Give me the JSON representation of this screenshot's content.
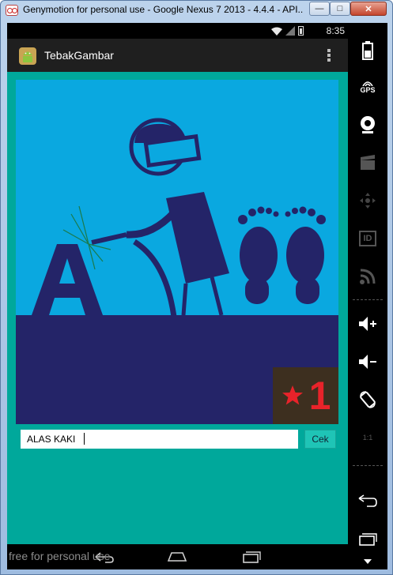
{
  "window": {
    "title": "Genymotion for personal use - Google Nexus 7 2013 - 4.4.4 - API...",
    "minimize_glyph": "—",
    "maximize_glyph": "□",
    "close_glyph": "✕"
  },
  "statusbar": {
    "time": "8:35"
  },
  "app": {
    "title": "TebakGambar"
  },
  "puzzle": {
    "level": "1"
  },
  "answer": {
    "value": "ALAS KAKI",
    "check_label": "Cek"
  },
  "watermark": "free for personal use",
  "toolbar": {
    "gps_label": "GPS",
    "id_label": "ID",
    "scale_label": "1:1"
  },
  "colors": {
    "content_bg": "#00a89b",
    "puzzle_sky": "#0aa8e0",
    "puzzle_ground": "#242468",
    "badge_bg": "#3d2f1f",
    "badge_fg": "#e8232a"
  }
}
